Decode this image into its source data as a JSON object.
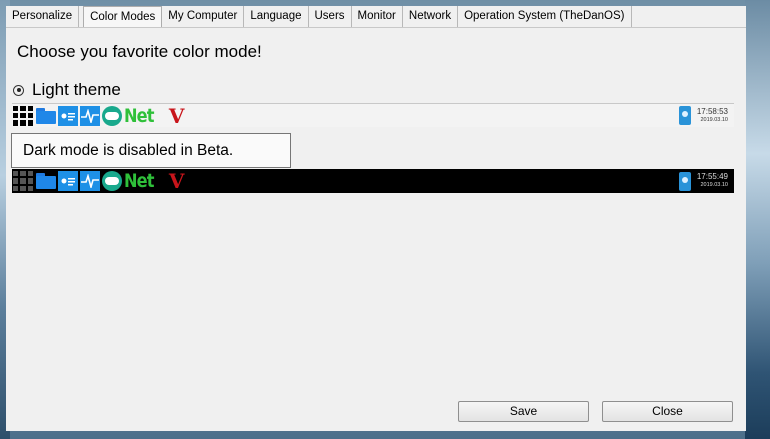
{
  "tabs": [
    {
      "label": "Personalize"
    },
    {
      "label": "Color Modes"
    },
    {
      "label": "My Computer"
    },
    {
      "label": "Language"
    },
    {
      "label": "Users"
    },
    {
      "label": "Monitor"
    },
    {
      "label": "Network"
    },
    {
      "label": "Operation System (TheDanOS)"
    }
  ],
  "active_tab": "Color Modes",
  "heading": "Choose you favorite color mode!",
  "light_theme": {
    "label": "Light theme",
    "selected": true
  },
  "taskbar_light": {
    "app_label": "Net",
    "logo": "V",
    "time": "17:58:53",
    "date": "2019.03.10"
  },
  "taskbar_dark": {
    "app_label": "Net",
    "logo": "V",
    "time": "17:55:49",
    "date": "2019.03.10"
  },
  "tooltip": "Dark mode is disabled in Beta.",
  "buttons": {
    "save": "Save",
    "close": "Close"
  },
  "icons": {
    "apps": "grid-icon",
    "files": "folder-icon",
    "contacts": "contact-card-icon",
    "monitor": "heartbeat-icon",
    "games": "gamepad-icon",
    "tray": "location-pin-icon"
  },
  "colors": {
    "accent": "#1e90e6",
    "net_green": "#2fc03a",
    "logo_red": "#c8151b"
  }
}
